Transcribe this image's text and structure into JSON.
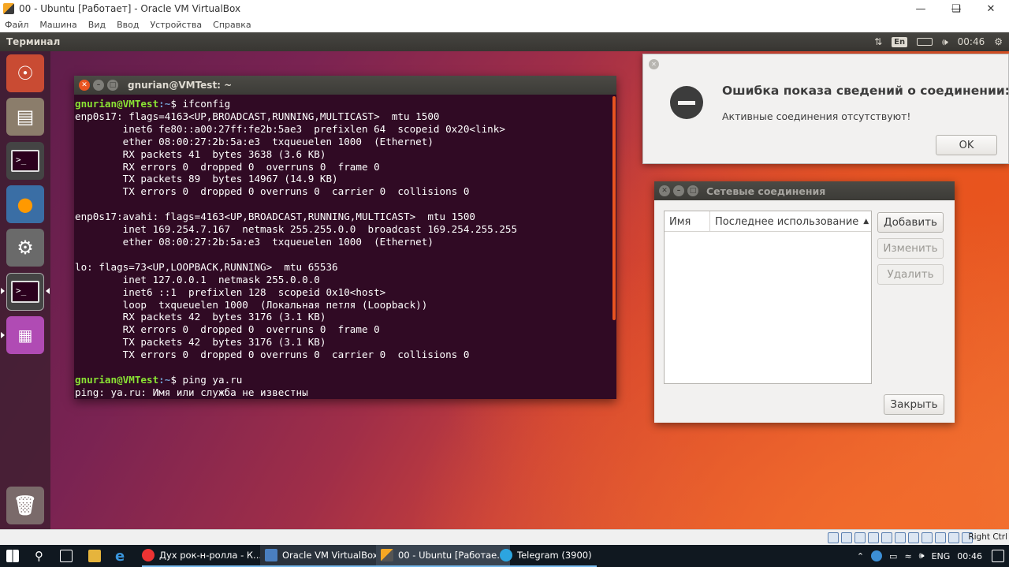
{
  "host_window": {
    "title": "00 - Ubuntu [Работает] - Oracle VM VirtualBox",
    "menu": [
      "Файл",
      "Машина",
      "Вид",
      "Ввод",
      "Устройства",
      "Справка"
    ]
  },
  "ubuntu_topbar": {
    "app_name": "Терминал",
    "keyboard_layout": "En",
    "time": "00:46"
  },
  "launcher": {
    "items": [
      "ubuntu-dash",
      "files",
      "terminal",
      "firefox",
      "system-settings",
      "terminal-active",
      "network-connections",
      "trash"
    ]
  },
  "terminal": {
    "title": "gnurian@VMTest: ~",
    "prompt_user": "gnurian@VMTest",
    "prompt_path": ":~",
    "cmd1": "$ ifconfig",
    "output1": "enp0s17: flags=4163<UP,BROADCAST,RUNNING,MULTICAST>  mtu 1500\n        inet6 fe80::a00:27ff:fe2b:5ae3  prefixlen 64  scopeid 0x20<link>\n        ether 08:00:27:2b:5a:e3  txqueuelen 1000  (Ethernet)\n        RX packets 41  bytes 3638 (3.6 KB)\n        RX errors 0  dropped 0  overruns 0  frame 0\n        TX packets 89  bytes 14967 (14.9 KB)\n        TX errors 0  dropped 0 overruns 0  carrier 0  collisions 0\n\nenp0s17:avahi: flags=4163<UP,BROADCAST,RUNNING,MULTICAST>  mtu 1500\n        inet 169.254.7.167  netmask 255.255.0.0  broadcast 169.254.255.255\n        ether 08:00:27:2b:5a:e3  txqueuelen 1000  (Ethernet)\n\nlo: flags=73<UP,LOOPBACK,RUNNING>  mtu 65536\n        inet 127.0.0.1  netmask 255.0.0.0\n        inet6 ::1  prefixlen 128  scopeid 0x10<host>\n        loop  txqueuelen 1000  (Локальная петля (Loopback))\n        RX packets 42  bytes 3176 (3.1 KB)\n        RX errors 0  dropped 0  overruns 0  frame 0\n        TX packets 42  bytes 3176 (3.1 KB)\n        TX errors 0  dropped 0 overruns 0  carrier 0  collisions 0\n",
    "cmd2": "$ ping ya.ru",
    "output2": "ping: ya.ru: Имя или служба не известны"
  },
  "error_dialog": {
    "title": "Ошибка показа сведений о соединении:",
    "message": "Активные соединения отсутствуют!",
    "ok_label": "OK"
  },
  "network_dialog": {
    "title": "Сетевые соединения",
    "columns": [
      "Имя",
      "Последнее использование"
    ],
    "sort_indicator": "▲",
    "buttons": {
      "add": "Добавить",
      "edit": "Изменить",
      "delete": "Удалить",
      "close": "Закрыть"
    }
  },
  "vbox_status": {
    "host_key": "Right Ctrl"
  },
  "taskbar": {
    "apps": [
      {
        "label": "Дух рок-н-ролла - К..."
      },
      {
        "label": "Oracle VM VirtualBox ..."
      },
      {
        "label": "00 - Ubuntu [Работае..."
      },
      {
        "label": "Telegram (3900)"
      }
    ],
    "lang": "ENG",
    "time": "00:46"
  }
}
